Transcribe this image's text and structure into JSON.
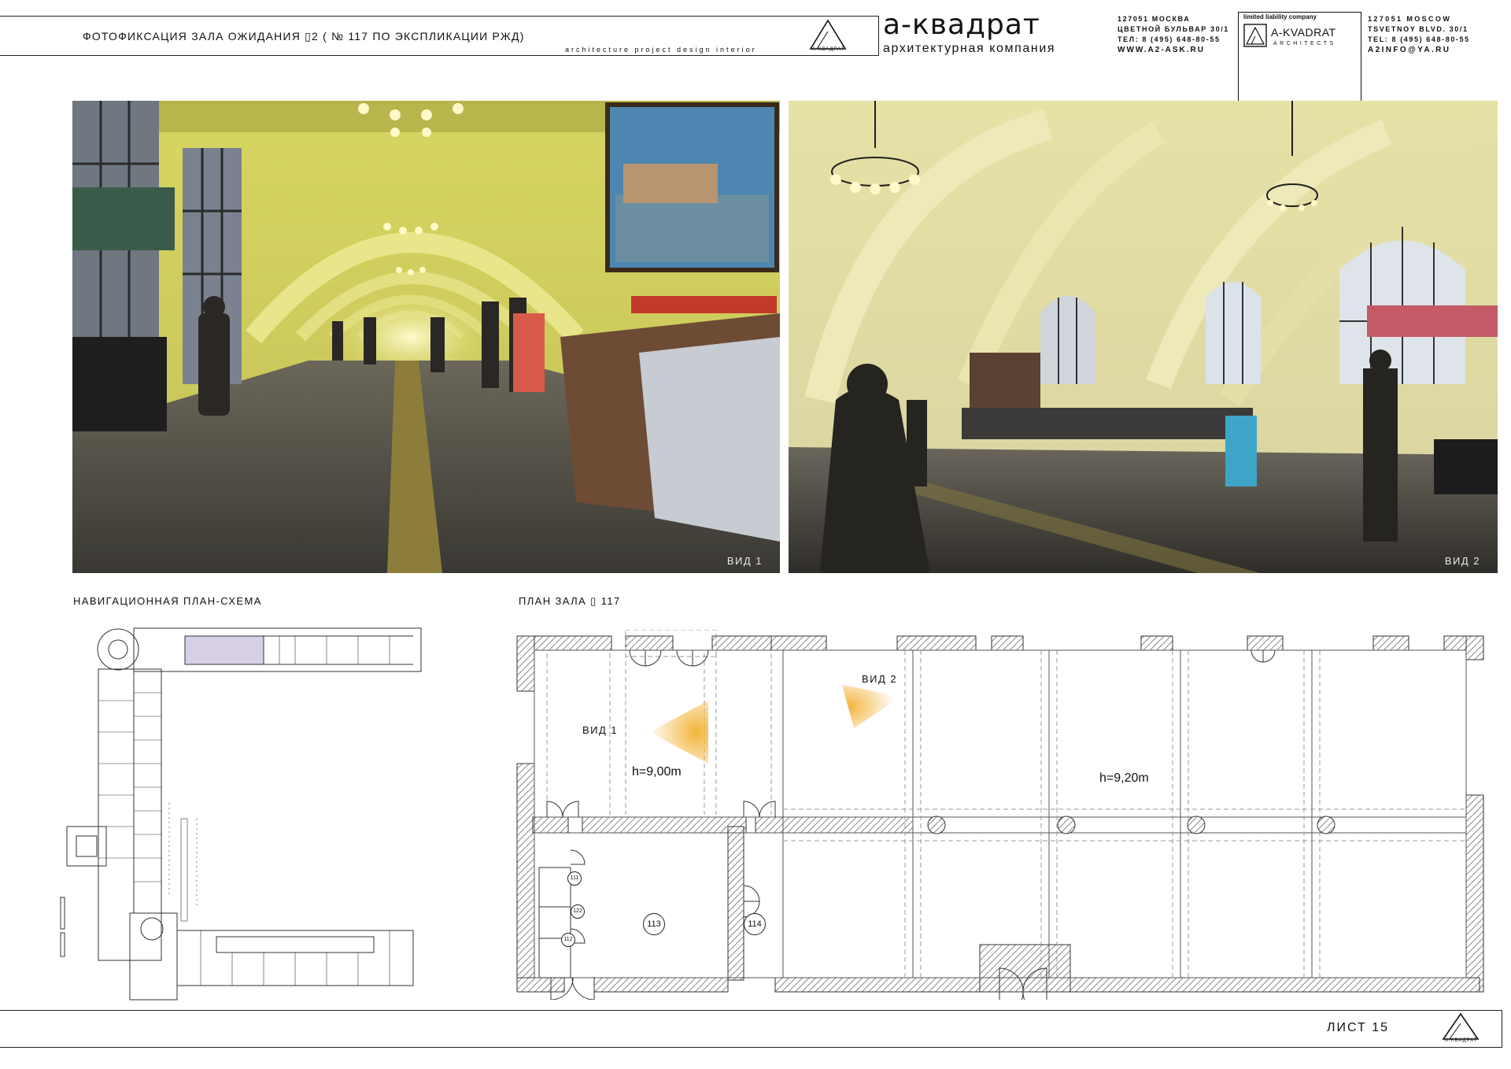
{
  "header": {
    "title": "ФОТОФИКСАЦИЯ  ЗАЛА ОЖИДАНИЯ ▯2  ( № 117 ПО ЭКСПЛИКАЦИИ РЖД)",
    "subtitle": "architecture   project   design   interior",
    "logo_small_text": "А-КВАДРАТ",
    "brand_name": "а-квадрат",
    "brand_tagline": "архитектурная компания",
    "address_ru": [
      "127051 МОСКВА",
      "ЦВЕТНОЙ БУЛЬВАР 30/1",
      "ТЕЛ: 8 (495) 648-80-55",
      "WWW.A2-ASK.RU"
    ],
    "llc_label": "limited liability company",
    "llc_name": "A-KVADRAT",
    "llc_sub": "ARCHITECTS",
    "address_en": [
      "127051 MOSCOW",
      "TSVETNOY BLVD. 30/1",
      "TEL: 8 (495) 648-80-55",
      "A2INFO@YA.RU"
    ]
  },
  "photos": {
    "view1_caption": "ВИД 1",
    "view2_caption": "ВИД 2"
  },
  "sections": {
    "nav_plan": "НАВИГАЦИОННАЯ ПЛАН-СХЕМА",
    "hall_plan": "ПЛАН ЗАЛА ▯ 117"
  },
  "plan": {
    "view1": "ВИД 1",
    "view2": "ВИД 2",
    "height_left": "h=9,00m",
    "height_right": "h=9,20m",
    "rooms": [
      "111",
      "122",
      "112",
      "113",
      "114"
    ]
  },
  "footer": {
    "sheet": "ЛИСТ 15",
    "logo_small_text": "А-КВАДРАТ"
  },
  "colors": {
    "accent_view_cone": "#f2b43a",
    "hatch": "#888888"
  }
}
